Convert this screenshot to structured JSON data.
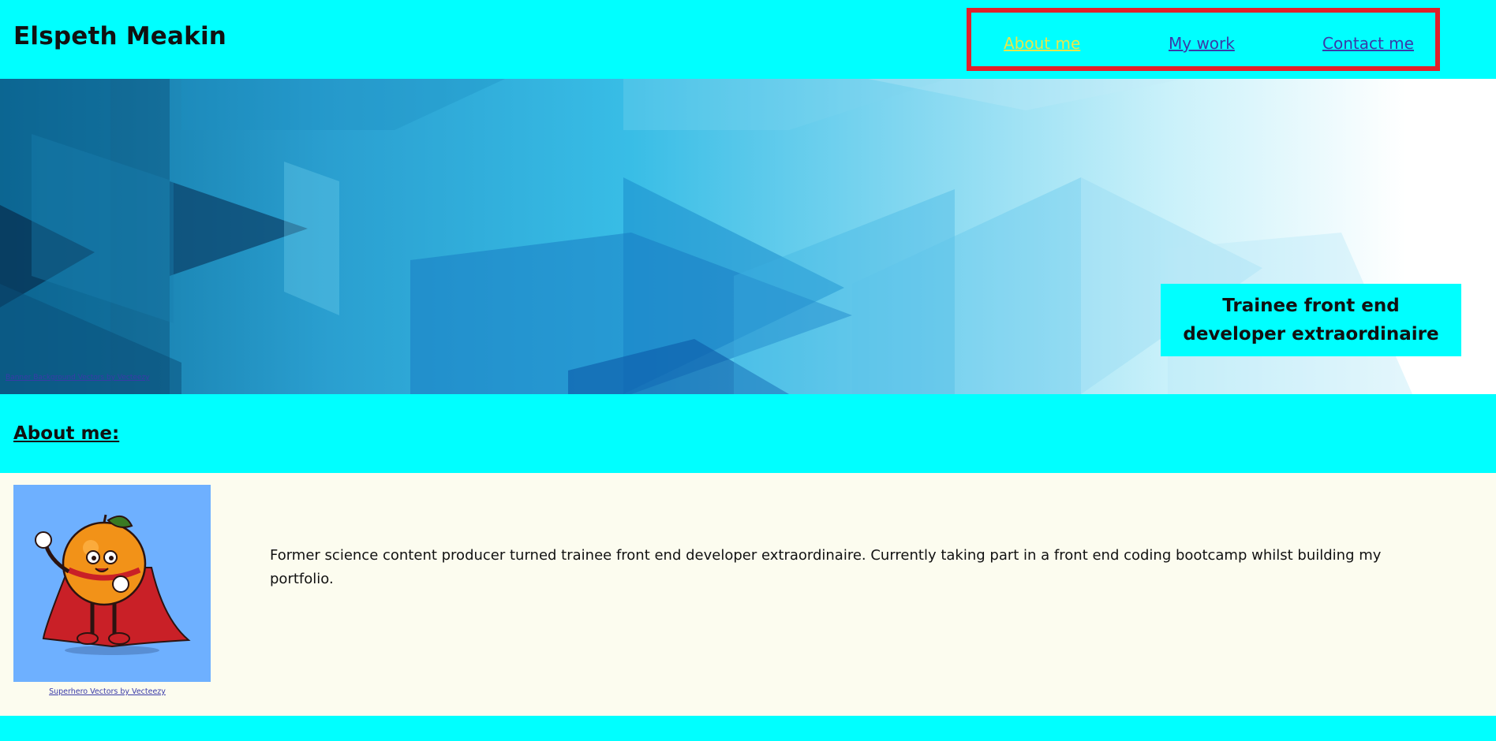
{
  "header": {
    "site_title": "Elspeth Meakin",
    "nav": [
      {
        "label": "About me",
        "active": true
      },
      {
        "label": "My work",
        "active": false
      },
      {
        "label": "Contact me",
        "active": false
      }
    ]
  },
  "banner": {
    "credit": "Banner Background Vectors by Vecteezy",
    "tagline": "Trainee front end developer extraordinaire"
  },
  "about": {
    "heading": "About me:",
    "image_credit": "Superhero Vectors by Vecteezy",
    "bio": "Former science content producer turned trainee front end developer extraordinaire. Currently taking part in a front end coding bootcamp whilst building my portfolio."
  },
  "colors": {
    "accent": "#00ffff",
    "nav_border": "#e0202a",
    "active_link": "#e8e84a",
    "link": "#3a3aa8",
    "content_bg": "#fcfcef",
    "avatar_bg": "#6eb0ff"
  }
}
